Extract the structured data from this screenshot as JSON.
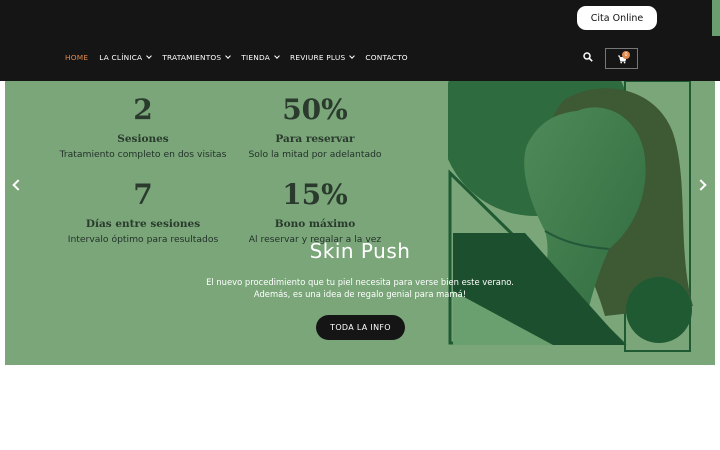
{
  "header": {
    "cta_label": "Cita Online",
    "nav": [
      {
        "label": "HOME",
        "active": true,
        "has_dropdown": false
      },
      {
        "label": "LA CLÍNICA",
        "active": false,
        "has_dropdown": true
      },
      {
        "label": "TRATAMIENTOS",
        "active": false,
        "has_dropdown": true
      },
      {
        "label": "TIENDA",
        "active": false,
        "has_dropdown": true
      },
      {
        "label": "REVIURE PLUS",
        "active": false,
        "has_dropdown": true
      },
      {
        "label": "CONTACTO",
        "active": false,
        "has_dropdown": false
      }
    ],
    "cart_count": "0"
  },
  "slider": {
    "stats": [
      {
        "num": "2",
        "label": "Sesiones",
        "sub": "Tratamiento completo en dos visitas"
      },
      {
        "num": "50%",
        "label": "Para reservar",
        "sub": "Solo la mitad por adelantado"
      },
      {
        "num": "7",
        "label": "Días entre sesiones",
        "sub": "Intervalo óptimo para resultados"
      },
      {
        "num": "15%",
        "label": "Bono máximo",
        "sub": "Al reservar y regalar a la vez"
      }
    ],
    "title": "Skin Push",
    "description": "El nuevo procedimiento que tu piel necesita para verse bien este verano. Además, es una idea de regalo genial para mamá!",
    "button_label": "TODA LA INFO"
  },
  "colors": {
    "header_bg": "#151515",
    "slide_bg": "#7aa67a",
    "accent": "#e0894a",
    "dark_green": "#1f5a33"
  }
}
